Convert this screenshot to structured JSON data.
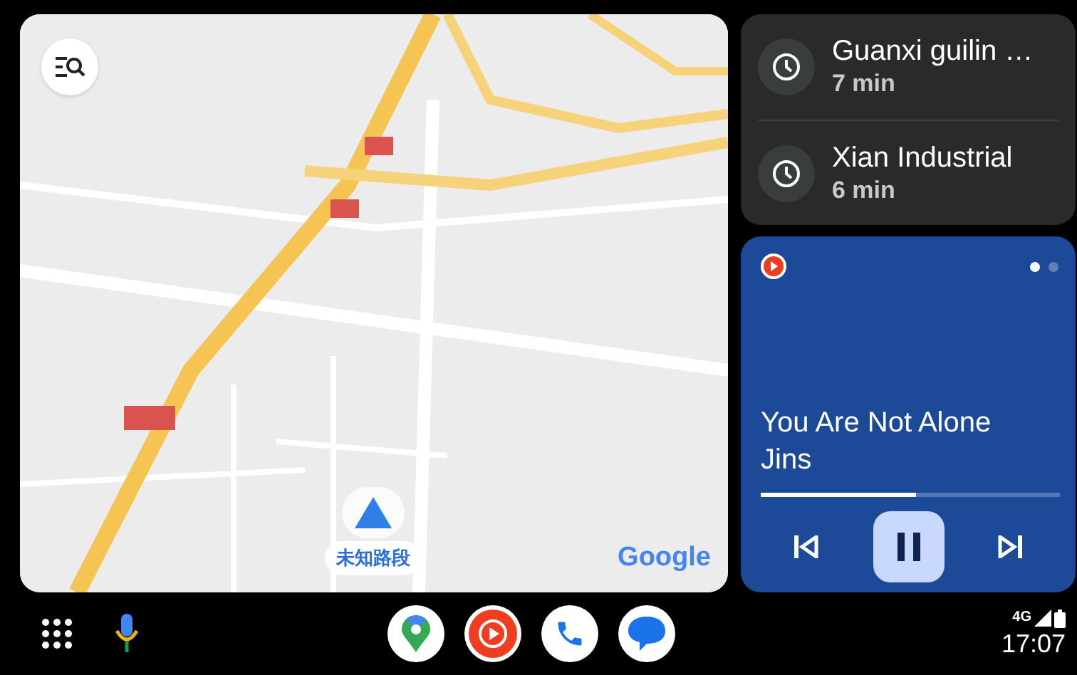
{
  "map": {
    "location_label": "未知路段",
    "attribution": "Google"
  },
  "destinations": [
    {
      "name": "Guanxi guilin …",
      "eta": "7 min"
    },
    {
      "name": "Xian Industrial",
      "eta": "6 min"
    }
  ],
  "media": {
    "title": "You Are Not Alone",
    "artist": "Jins",
    "level": 0.52,
    "playing": true,
    "pages": [
      {
        "selected": true
      },
      {
        "selected": false
      }
    ]
  },
  "status": {
    "network": "4G",
    "time": "17:07"
  }
}
